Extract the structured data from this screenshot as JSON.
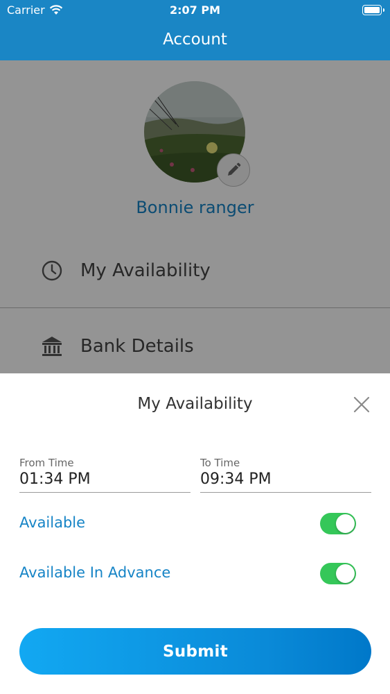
{
  "status_bar": {
    "carrier": "Carrier",
    "time": "2:07 PM"
  },
  "header": {
    "title": "Account"
  },
  "profile": {
    "name": "Bonnie ranger"
  },
  "menu": {
    "items": [
      {
        "label": "My Availability",
        "icon": "clock-icon"
      },
      {
        "label": "Bank Details",
        "icon": "bank-icon"
      }
    ]
  },
  "modal": {
    "title": "My Availability",
    "from_time": {
      "label": "From Time",
      "value": "01:34 PM"
    },
    "to_time": {
      "label": "To Time",
      "value": "09:34 PM"
    },
    "toggles": [
      {
        "label": "Available",
        "on": true
      },
      {
        "label": "Available In Advance",
        "on": true
      }
    ],
    "submit_label": "Submit"
  },
  "colors": {
    "primary": "#1a86c5",
    "link": "#1684c6",
    "toggle_on": "#35c759"
  }
}
